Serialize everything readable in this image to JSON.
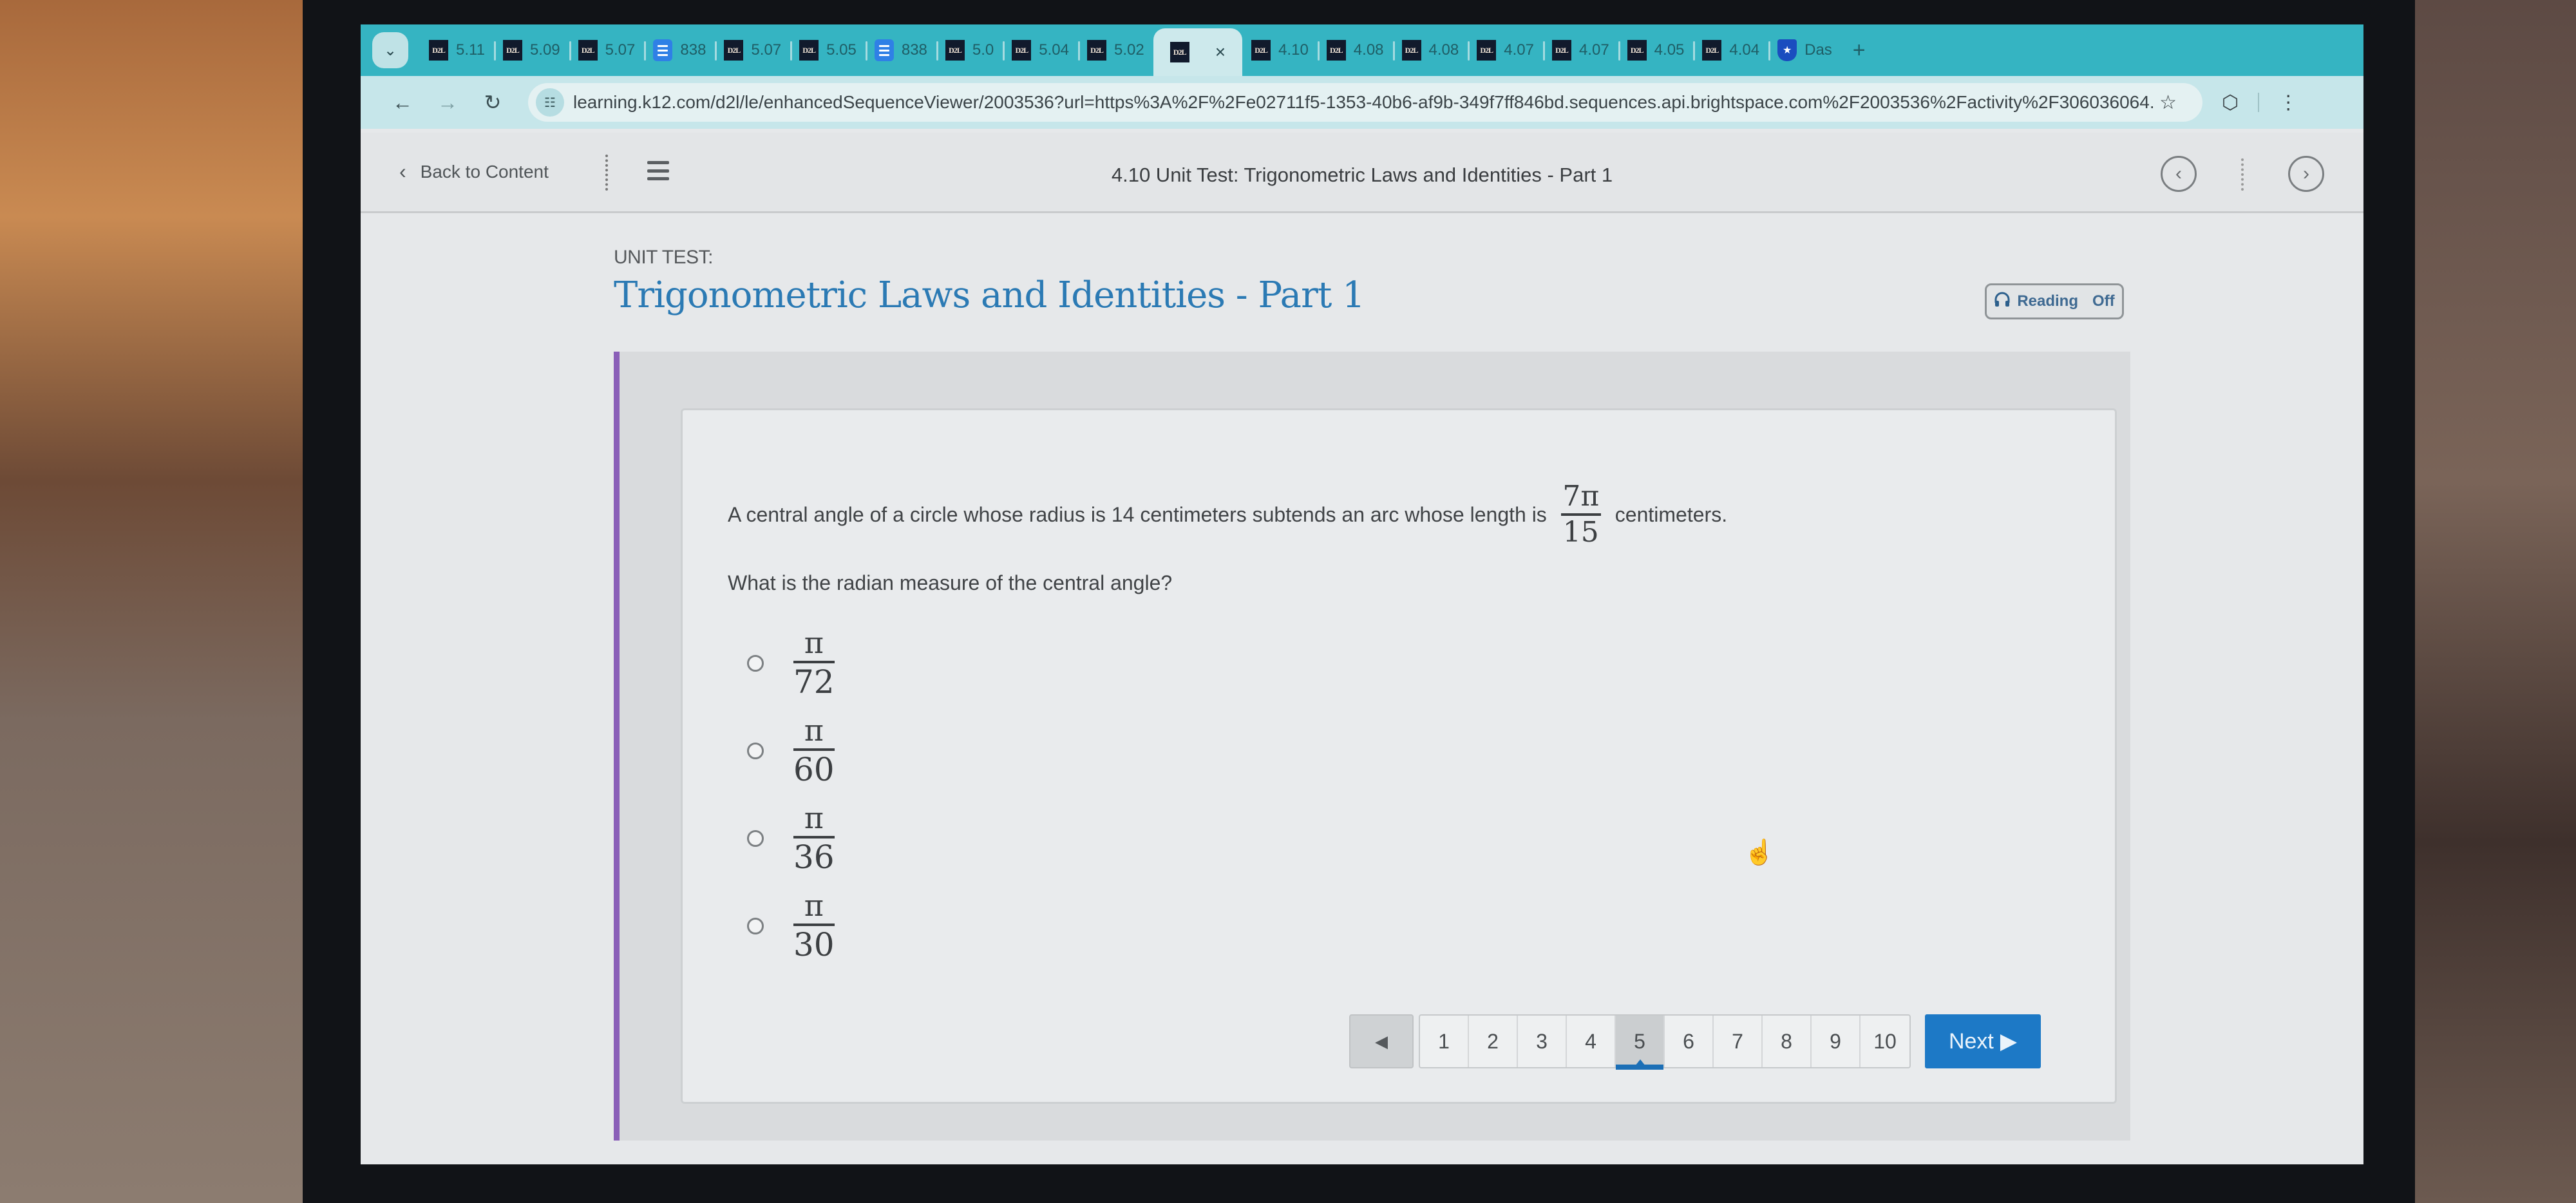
{
  "browser": {
    "tabs": [
      {
        "favicon": "d2l",
        "label": "5.11"
      },
      {
        "favicon": "d2l",
        "label": "5.09"
      },
      {
        "favicon": "d2l",
        "label": "5.07"
      },
      {
        "favicon": "doc",
        "label": "838"
      },
      {
        "favicon": "d2l",
        "label": "5.07"
      },
      {
        "favicon": "d2l",
        "label": "5.05"
      },
      {
        "favicon": "doc",
        "label": "838"
      },
      {
        "favicon": "d2l",
        "label": "5.0"
      },
      {
        "favicon": "d2l",
        "label": "5.04"
      },
      {
        "favicon": "d2l",
        "label": "5.02"
      },
      {
        "favicon": "d2l",
        "label": "",
        "active": true
      },
      {
        "favicon": "d2l",
        "label": "4.10"
      },
      {
        "favicon": "d2l",
        "label": "4.08"
      },
      {
        "favicon": "d2l",
        "label": "4.08"
      },
      {
        "favicon": "d2l",
        "label": "4.07"
      },
      {
        "favicon": "d2l",
        "label": "4.07"
      },
      {
        "favicon": "d2l",
        "label": "4.05"
      },
      {
        "favicon": "d2l",
        "label": "4.04"
      },
      {
        "favicon": "shield",
        "label": "Das"
      }
    ],
    "tab_close_glyph": "×",
    "new_tab_glyph": "+",
    "tab_menu_glyph": "⌄",
    "url": "learning.k12.com/d2l/le/enhancedSequenceViewer/2003536?url=https%3A%2F%2Fe02711f5-1353-40b6-af9b-349f7ff846bd.sequences.api.brightspace.com%2F2003536%2Factivity%2F306036064...",
    "icons": {
      "back": "←",
      "forward": "→",
      "reload": "↻",
      "site_info": "☷",
      "star": "☆",
      "extension": "⬡",
      "menu": "⋮"
    }
  },
  "header": {
    "back_label": "Back to Content",
    "back_glyph": "‹",
    "title": "4.10 Unit Test: Trigonometric Laws and Identities - Part 1",
    "prev_glyph": "‹",
    "next_glyph": "›"
  },
  "content": {
    "eyebrow": "UNIT TEST:",
    "title": "Trigonometric Laws and Identities - Part 1",
    "reading": {
      "icon": "🎧",
      "label": "Reading",
      "state": "Off"
    }
  },
  "question": {
    "stem_before": "A central angle of a circle whose radius is 14 centimeters subtends an arc whose length is",
    "stem_fraction": {
      "numerator": "7π",
      "denominator": "15"
    },
    "stem_after": "centimeters.",
    "prompt": "What is the radian measure of the central angle?",
    "choices": [
      {
        "numerator": "π",
        "denominator": "72",
        "selected": false
      },
      {
        "numerator": "π",
        "denominator": "60",
        "selected": false
      },
      {
        "numerator": "π",
        "denominator": "36",
        "selected": false
      },
      {
        "numerator": "π",
        "denominator": "30",
        "selected": false
      }
    ]
  },
  "pagination": {
    "prev_glyph": "◀",
    "pages": [
      "1",
      "2",
      "3",
      "4",
      "5",
      "6",
      "7",
      "8",
      "9",
      "10"
    ],
    "current_page": "5",
    "next_label": "Next",
    "next_glyph": "▶"
  },
  "cursor_glyph": "☝"
}
